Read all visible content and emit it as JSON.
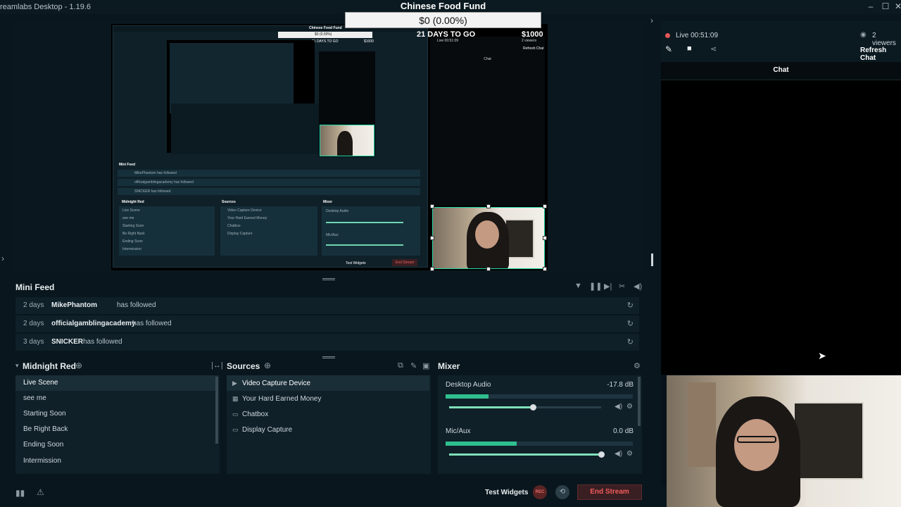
{
  "titlebar": {
    "title": "reamlabs Desktop - 1.19.6",
    "minimize": "–",
    "maximize": "☐",
    "close": "✕"
  },
  "fund_widget": {
    "title": "Chinese Food Fund",
    "amount": "$0 (0.00%)",
    "days_left": "21 DAYS TO GO",
    "goal": "$1000"
  },
  "nested_preview": {
    "fund_title": "Chinese Food Fund",
    "fund_amount": "$0 (0.00%)",
    "days": "21 DAYS TO GO",
    "goal": "$1000",
    "live": "Live 00:51:09",
    "viewers": "2 viewers",
    "refresh": "Refresh Chat",
    "chat_label": "Chat",
    "minifeed_label": "Mini Feed",
    "feed": [
      "MikePhantom has followed",
      "officialgamblingacademy has followed",
      "SNICKER has followed"
    ],
    "scenes_label": "Midnight Red",
    "sources_label": "Sources",
    "mixer_label": "Mixer",
    "scenes": [
      "Live Scene",
      "see me",
      "Starting Soon",
      "Be Right Back",
      "Ending Soon",
      "Intermission"
    ],
    "sources": [
      "Video Capture Device",
      "Your Hard Earned Money",
      "Chatbox",
      "Display Capture"
    ],
    "desktop_audio": "Desktop Audio",
    "mic": "Mic/Aux",
    "test_widgets": "Test Widgets",
    "end_stream": "End Stream"
  },
  "mini_feed": {
    "title": "Mini Feed",
    "events": [
      {
        "age": "2 days",
        "user": "MikePhantom",
        "action": "has followed"
      },
      {
        "age": "2 days",
        "user": "officialgamblingacademy",
        "action": "has followed"
      },
      {
        "age": "3 days",
        "user": "SNICKER",
        "action": "has followed"
      }
    ]
  },
  "scenes": {
    "collection": "Midnight Red",
    "items": [
      "Live Scene",
      "see me",
      "Starting Soon",
      "Be Right Back",
      "Ending Soon",
      "Intermission"
    ],
    "active": "Live Scene"
  },
  "sources": {
    "title": "Sources",
    "items": [
      {
        "name": "Video Capture Device",
        "icon": "camera-icon"
      },
      {
        "name": "Your Hard Earned Money",
        "icon": "widget-icon"
      },
      {
        "name": "Chatbox",
        "icon": "chat-icon"
      },
      {
        "name": "Display Capture",
        "icon": "monitor-icon"
      }
    ]
  },
  "mixer": {
    "title": "Mixer",
    "channels": [
      {
        "name": "Desktop Audio",
        "db": "-17.8 dB",
        "meter_level": 0.23,
        "volume": 0.55
      },
      {
        "name": "Mic/Aux",
        "db": "0.0 dB",
        "meter_level": 0.38,
        "volume": 1.0
      }
    ]
  },
  "footer": {
    "test_widgets": "Test Widgets",
    "rec": "REC",
    "end_stream": "End Stream"
  },
  "chat_panel": {
    "live_time": "Live 00:51:09",
    "viewers": "2 viewers",
    "refresh": "Refresh Chat",
    "header": "Chat"
  },
  "colors": {
    "accent": "#2fbf8f",
    "live_red": "#e55656",
    "end_stream_red": "#f25b5b",
    "panel_bg": "#0f2029",
    "app_bg": "#09161d"
  }
}
